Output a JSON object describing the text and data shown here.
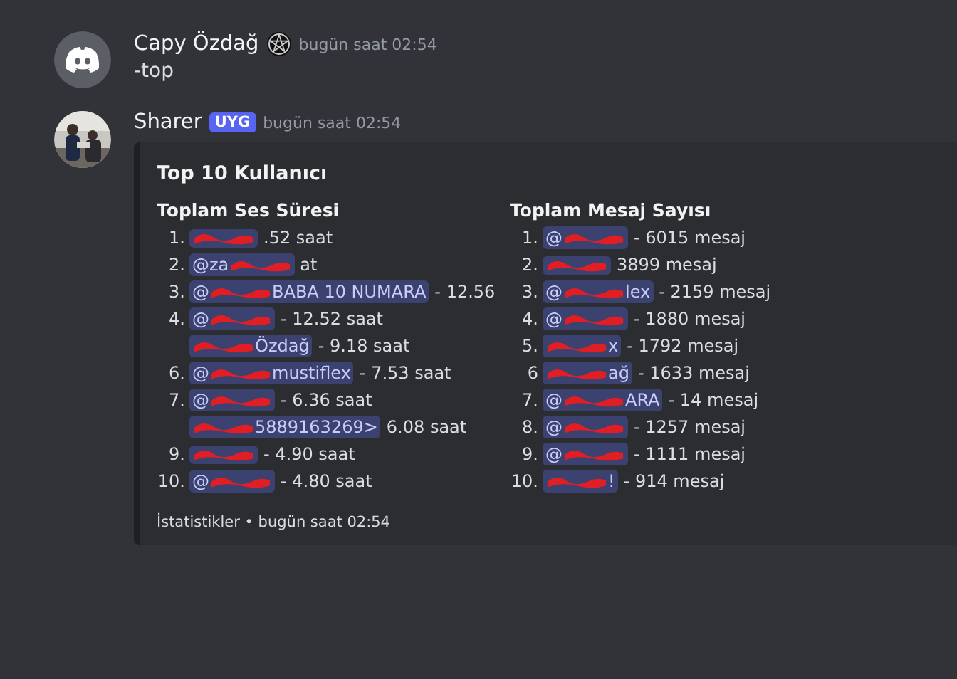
{
  "messages": [
    {
      "author": "Capy Özdağ",
      "kind": "default_avatar",
      "badge_icon": true,
      "time": "bugün saat 02:54",
      "text": "-top"
    },
    {
      "author": "Sharer",
      "kind": "photo_avatar",
      "tag": "UYG",
      "time": "bugün saat 02:54",
      "embed": {
        "title": "Top 10 Kullanıcı",
        "fields": [
          {
            "name": "Toplam Ses Süresi",
            "items": [
              {
                "num": "1.",
                "redacted": true,
                "detail": ".52 saat"
              },
              {
                "num": "2.",
                "mention": "@za",
                "redacted": true,
                "detail": "at"
              },
              {
                "num": "3.",
                "mention": "@",
                "redacted": true,
                "mention_end": "BABA 10 NUMARA",
                "detail": "- 12.56"
              },
              {
                "num": "4.",
                "mention": "@",
                "redacted": true,
                "detail": "- 12.52 saat"
              },
              {
                "redacted": true,
                "mention_end": "Özdağ",
                "detail": "- 9.18 saat"
              },
              {
                "num": "6.",
                "mention": "@",
                "redacted": true,
                "mention_end": "mustiflex",
                "detail": "- 7.53 saat"
              },
              {
                "num": "7.",
                "mention": "@",
                "redacted": true,
                "detail": "- 6.36 saat"
              },
              {
                "redacted": true,
                "mention_end": "5889163269>",
                "detail": "6.08 saat"
              },
              {
                "num": "9.",
                "redacted": true,
                "detail": "- 4.90 saat"
              },
              {
                "num": "10.",
                "mention": "@",
                "redacted": true,
                "detail": "- 4.80 saat"
              }
            ]
          },
          {
            "name": "Toplam Mesaj Sayısı",
            "items": [
              {
                "num": "1.",
                "mention": "@",
                "redacted": true,
                "detail": "- 6015 mesaj"
              },
              {
                "num": "2.",
                "redacted": true,
                "detail": "3899 mesaj"
              },
              {
                "num": "3.",
                "mention": "@",
                "redacted": true,
                "mention_end": "lex",
                "detail": "- 2159 mesaj"
              },
              {
                "num": "4.",
                "mention": "@",
                "redacted": true,
                "detail": "- 1880 mesaj"
              },
              {
                "num": "5.",
                "redacted": true,
                "mention_end": "x",
                "detail": "- 1792 mesaj"
              },
              {
                "num": "6",
                "redacted": true,
                "mention_end": "ağ",
                "detail": "- 1633 mesaj"
              },
              {
                "num": "7.",
                "mention": "@",
                "redacted": true,
                "mention_end": "ARA",
                "detail": "- 14 mesaj"
              },
              {
                "num": "8.",
                "mention": "@",
                "redacted": true,
                "detail": "- 1257 mesaj"
              },
              {
                "num": "9.",
                "mention": "@",
                "redacted": true,
                "detail": "- 1111 mesaj"
              },
              {
                "num": "10.",
                "redacted": true,
                "mention_end": "!",
                "detail": "- 914 mesaj"
              }
            ]
          }
        ],
        "footer": "İstatistikler • bugün saat 02:54"
      }
    }
  ]
}
